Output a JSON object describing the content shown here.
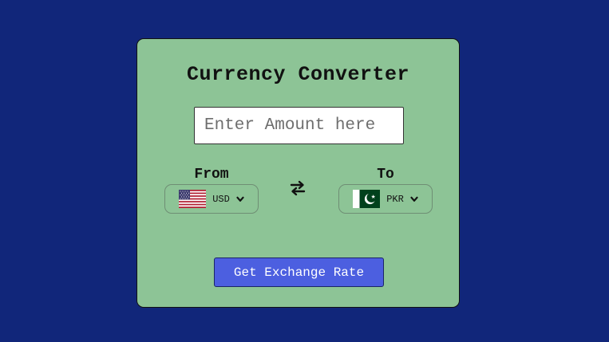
{
  "app": {
    "title": "Currency Converter"
  },
  "amount": {
    "value": "",
    "placeholder": "Enter Amount here"
  },
  "from": {
    "label": "From",
    "currency": "USD",
    "flag_icon": "us-flag-icon"
  },
  "to": {
    "label": "To",
    "currency": "PKR",
    "flag_icon": "pk-flag-icon"
  },
  "swap": {
    "icon": "swap-arrows-icon"
  },
  "action": {
    "label": "Get Exchange Rate"
  },
  "colors": {
    "page_background": "#11267a",
    "card_background": "#8dc496",
    "button": "#4c5fe0",
    "button_text": "#ffffff"
  }
}
